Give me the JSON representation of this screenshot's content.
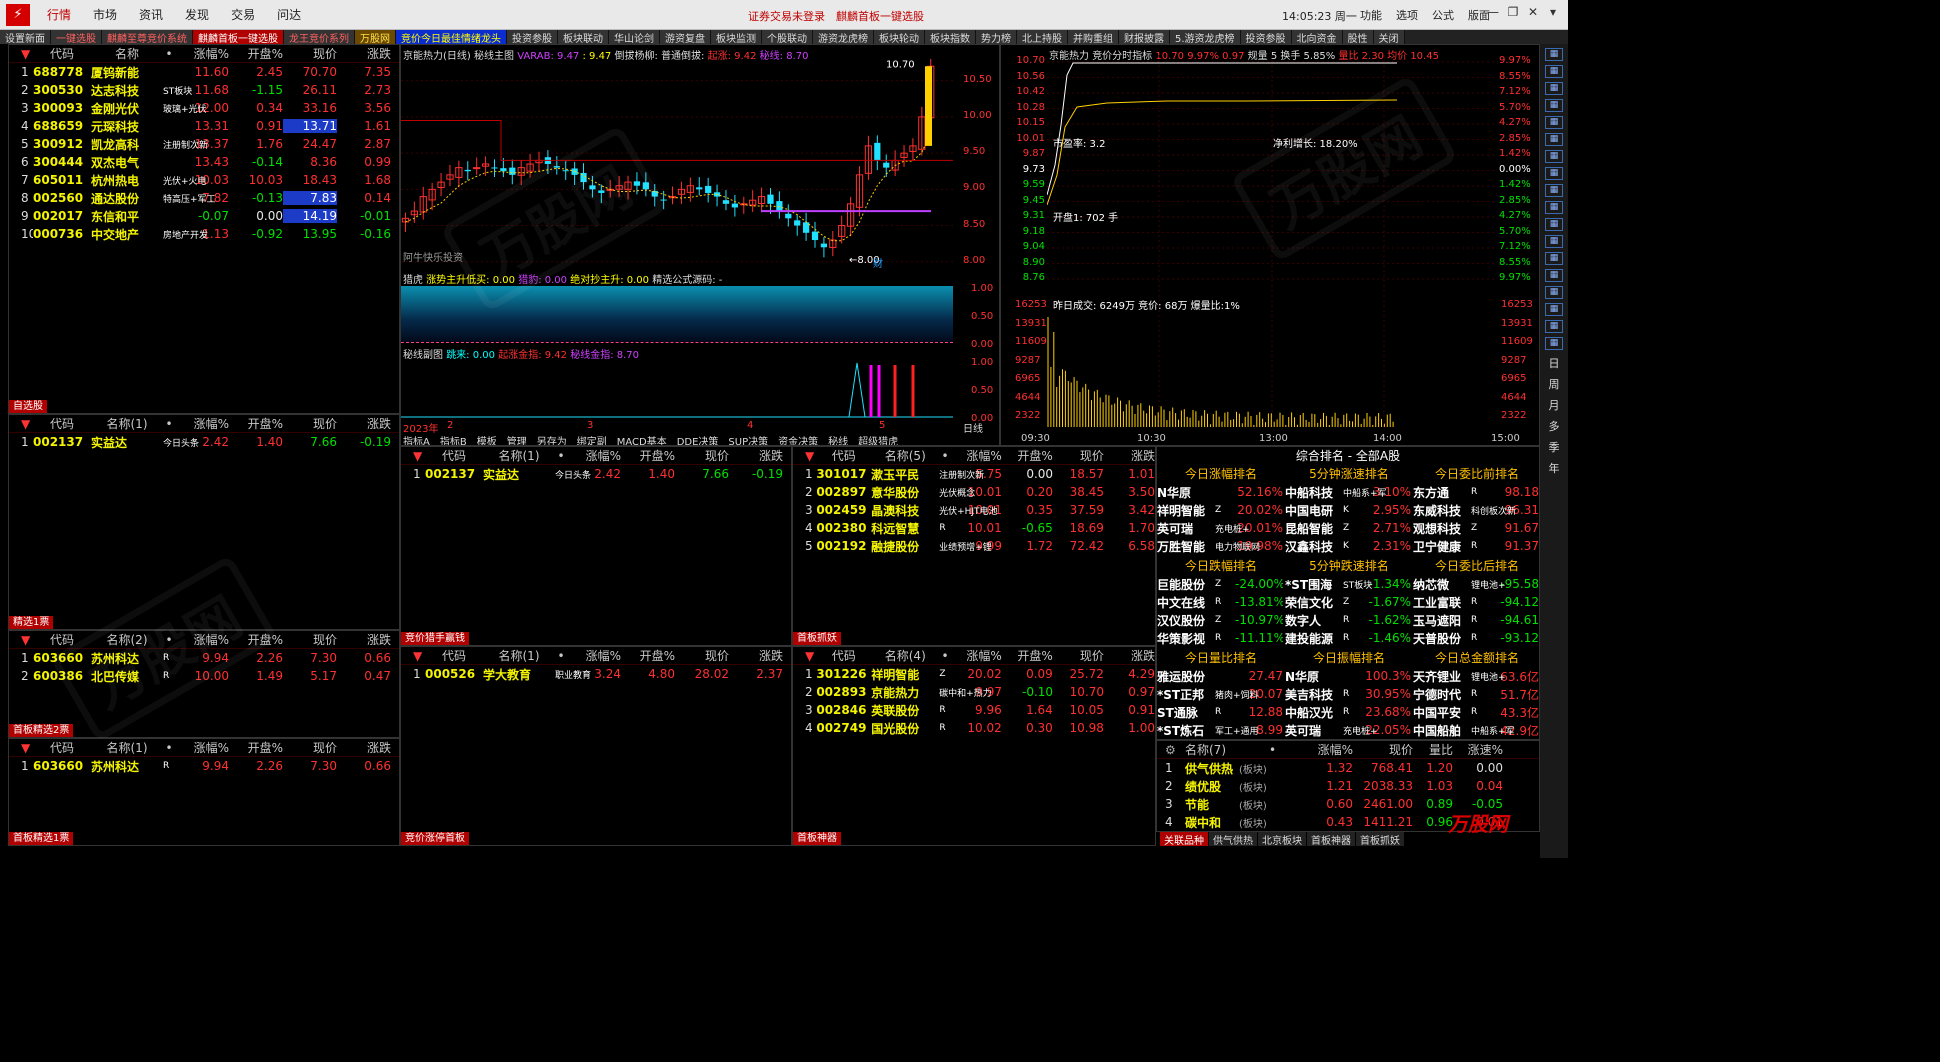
{
  "menu": {
    "items": [
      "行情",
      "市场",
      "资讯",
      "发现",
      "交易",
      "问达"
    ],
    "notice": "证券交易未登录　麒麟首板一键选股",
    "clock": "14:05:23 周一",
    "right": [
      "功能",
      "选项",
      "公式",
      "版面"
    ]
  },
  "tabs": [
    {
      "label": "设置新面",
      "cls": ""
    },
    {
      "label": "一键选股",
      "cls": "red"
    },
    {
      "label": "麒麟至尊竞价系统",
      "cls": "red"
    },
    {
      "label": "麒麟首板一键选股",
      "cls": "sel"
    },
    {
      "label": "龙王竞价系列",
      "cls": "red"
    },
    {
      "label": "万股网",
      "cls": "gold"
    },
    {
      "label": "竞价今日最佳情绪龙头",
      "cls": "blue"
    },
    {
      "label": "投资参股",
      "cls": ""
    },
    {
      "label": "板块联动",
      "cls": ""
    },
    {
      "label": "华山论剑",
      "cls": ""
    },
    {
      "label": "游资复盘",
      "cls": ""
    },
    {
      "label": "板块监测",
      "cls": ""
    },
    {
      "label": "个股联动",
      "cls": ""
    },
    {
      "label": "游资龙虎榜",
      "cls": ""
    },
    {
      "label": "板块轮动",
      "cls": ""
    },
    {
      "label": "板块指数",
      "cls": ""
    },
    {
      "label": "势力榜",
      "cls": ""
    },
    {
      "label": "北上持股",
      "cls": ""
    },
    {
      "label": "并购重组",
      "cls": ""
    },
    {
      "label": "财报披露",
      "cls": ""
    },
    {
      "label": "5.游资龙虎榜",
      "cls": ""
    },
    {
      "label": "投资参股",
      "cls": ""
    },
    {
      "label": "北向资金",
      "cls": ""
    },
    {
      "label": "股性",
      "cls": ""
    },
    {
      "label": "关闭",
      "cls": ""
    }
  ],
  "cols": [
    "代码",
    "名称",
    "•",
    "涨幅%",
    "开盘%",
    "现价",
    "涨跌"
  ],
  "main": {
    "rows": [
      [
        "1",
        "688778",
        "厦钨新能",
        "",
        "11.60",
        "2.45",
        "70.70",
        "7.35",
        "",
        ""
      ],
      [
        "2",
        "300530",
        "达志科技",
        "ST板块",
        "11.68",
        "-1.15",
        "26.11",
        "2.73",
        "",
        ""
      ],
      [
        "3",
        "300093",
        "金刚光伏",
        "玻璃+光伏",
        "12.00",
        "0.34",
        "33.16",
        "3.56",
        "",
        ""
      ],
      [
        "4",
        "688659",
        "元琛科技",
        "",
        "13.31",
        "0.91",
        "13.71",
        "1.61",
        "",
        "hl"
      ],
      [
        "5",
        "300912",
        "凯龙高科",
        "注册制次新",
        "13.37",
        "1.76",
        "24.47",
        "2.87",
        "",
        ""
      ],
      [
        "6",
        "300444",
        "双杰电气",
        "",
        "13.43",
        "-0.14",
        "8.36",
        "0.99",
        "",
        ""
      ],
      [
        "7",
        "605011",
        "杭州热电",
        "光伏+火电",
        "10.03",
        "10.03",
        "18.43",
        "1.68",
        "",
        ""
      ],
      [
        "8",
        "002560",
        "通达股份",
        "特高压+军工",
        "7.82",
        "-0.13",
        "7.83",
        "0.14",
        "",
        "hl"
      ],
      [
        "9",
        "002017",
        "东信和平",
        "",
        "-0.07",
        "0.00",
        "14.19",
        "-0.01",
        "",
        "hl"
      ],
      [
        "10",
        "000736",
        "中交地产",
        "房地产开发",
        "1.13",
        "-0.92",
        "13.95",
        "-0.16",
        "",
        ""
      ]
    ],
    "tag": "自选股"
  },
  "p2": {
    "cols": [
      "代码",
      "名称(1)",
      "•",
      "涨幅%",
      "开盘%",
      "现价",
      "涨跌"
    ],
    "rows": [
      [
        "1",
        "002137",
        "实益达",
        "今日头条",
        "2.42",
        "1.40",
        "7.66",
        "-0.19"
      ]
    ],
    "tag": "精选1票"
  },
  "p3": {
    "cols": [
      "代码",
      "名称(2)",
      "•",
      "涨幅%",
      "开盘%",
      "现价",
      "涨跌"
    ],
    "rows": [
      [
        "1",
        "603660",
        "苏州科达",
        "R",
        "9.94",
        "2.26",
        "7.30",
        "0.66"
      ],
      [
        "2",
        "600386",
        "北巴传媒",
        "R",
        "10.00",
        "1.49",
        "5.17",
        "0.47"
      ]
    ],
    "tag": "首板精选2票"
  },
  "p4": {
    "cols": [
      "代码",
      "名称(1)",
      "•",
      "涨幅%",
      "开盘%",
      "现价",
      "涨跌"
    ],
    "rows": [
      [
        "1",
        "603660",
        "苏州科达",
        "R",
        "9.94",
        "2.26",
        "7.30",
        "0.66"
      ]
    ],
    "tag": "首板精选1票"
  },
  "p5": {
    "cols": [
      "代码",
      "名称(1)",
      "•",
      "涨幅%",
      "开盘%",
      "现价",
      "涨跌"
    ],
    "rows": [
      [
        "1",
        "002137",
        "实益达",
        "今日头条",
        "2.42",
        "1.40",
        "7.66",
        "-0.19"
      ]
    ],
    "tag": "竞价猎手赢钱"
  },
  "p6": {
    "cols": [
      "代码",
      "名称(1)",
      "•",
      "涨幅%",
      "开盘%",
      "现价",
      "涨跌"
    ],
    "rows": [
      [
        "1",
        "000526",
        "学大教育",
        "职业教育",
        "3.24",
        "4.80",
        "28.02",
        "2.37"
      ]
    ],
    "tag": "竞价涨停首板"
  },
  "p7": {
    "cols": [
      "代码",
      "名称(5)",
      "•",
      "涨幅%",
      "开盘%",
      "现价",
      "涨跌"
    ],
    "rows": [
      [
        "1",
        "301017",
        "漱玉平民",
        "注册制次新",
        "5.75",
        "0.00",
        "18.57",
        "1.01"
      ],
      [
        "2",
        "002897",
        "意华股份",
        "光伏概念",
        "10.01",
        "0.20",
        "38.45",
        "3.50"
      ],
      [
        "3",
        "002459",
        "晶澳科技",
        "光伏+HJT电池",
        "10.01",
        "0.35",
        "37.59",
        "3.42"
      ],
      [
        "4",
        "002380",
        "科远智慧",
        "R",
        "10.01",
        "-0.65",
        "18.69",
        "1.70"
      ],
      [
        "5",
        "002192",
        "融捷股份",
        "业绩预增+锂",
        "9.99",
        "1.72",
        "72.42",
        "6.58"
      ]
    ],
    "tag": "首板抓妖"
  },
  "p8": {
    "cols": [
      "代码",
      "名称(4)",
      "•",
      "涨幅%",
      "开盘%",
      "现价",
      "涨跌"
    ],
    "rows": [
      [
        "1",
        "301226",
        "祥明智能",
        "Z",
        "20.02",
        "0.09",
        "25.72",
        "4.29"
      ],
      [
        "2",
        "002893",
        "京能热力",
        "碳中和+热力",
        "9.97",
        "-0.10",
        "10.70",
        "0.97"
      ],
      [
        "3",
        "002846",
        "英联股份",
        "R",
        "9.96",
        "1.64",
        "10.05",
        "0.91"
      ],
      [
        "4",
        "002749",
        "国光股份",
        "R",
        "10.02",
        "0.30",
        "10.98",
        "1.00"
      ]
    ],
    "tag": "首板神器"
  },
  "kline": {
    "title": "京能热力(日线)",
    "sub": "秘线主图",
    "vara": "VARAB: 9.47",
    "v2": ": 9.47",
    "b1": "倒拔杨柳:",
    "b2": "普通倒拔:",
    "b3": "起涨: 9.42",
    "b4": "秘线: 8.70",
    "hi": "10.70",
    "lo": "8.00",
    "cai": "财",
    "wm": "阿牛快乐投资",
    "y": [
      "10.50",
      "10.00",
      "9.50",
      "9.00",
      "8.50",
      "8.00"
    ],
    "ind1": {
      "title": "猎虎",
      "a": "涨势主升低买: 0.00",
      "b": "猎豹: 0.00",
      "c": "绝对抄主升: 0.00",
      "d": "精选公式源码: -",
      "y": [
        "1.00",
        "0.50",
        "0.00"
      ]
    },
    "ind2": {
      "title": "秘线副图",
      "a": "跳来: 0.00",
      "b": "起涨金指: 9.42",
      "c": "秘线金指: 8.70",
      "y": [
        "1.00",
        "0.50",
        "0.00"
      ]
    },
    "xaxis": [
      "2023年",
      "2",
      "3",
      "4",
      "5"
    ],
    "xtail": "日线",
    "tabs": [
      "指标A",
      "指标B",
      "模板",
      "管理",
      "另存为",
      "绑定副",
      "MACD基本",
      "DDE决策",
      "SUP决策",
      "资金决策",
      "秘线",
      "超级猎虎"
    ]
  },
  "intraday": {
    "title": "京能热力",
    "sub": "竞价分时指标",
    "price": "10.70",
    "pct": "9.97%",
    "chg": "0.97",
    "vol": "规量",
    "hs": "5 换手 5.85%",
    "lb": "量比 2.30",
    "avg": "均价 10.45",
    "ly": [
      "10.70",
      "10.56",
      "10.42",
      "10.28",
      "10.15",
      "10.01",
      "9.87",
      "9.73",
      "9.59",
      "9.45",
      "9.31",
      "9.18",
      "9.04",
      "8.90",
      "8.76"
    ],
    "ry": [
      "9.97%",
      "8.55%",
      "7.12%",
      "5.70%",
      "4.27%",
      "2.85%",
      "1.42%",
      "0.00%",
      "1.42%",
      "2.85%",
      "4.27%",
      "5.70%",
      "7.12%",
      "8.55%",
      "9.97%"
    ],
    "vy": [
      "16253",
      "13931",
      "11609",
      "9287",
      "6965",
      "4644",
      "2322"
    ],
    "t1": "市盈率: 3.2",
    "t2": "净利增长: 18.20%",
    "t3": "开盘1: 702 手",
    "t4": "昨日成交: 6249万 竞价: 68万 爆量比:1%",
    "x": [
      "09:30",
      "10:30",
      "13:00",
      "14:00",
      "15:00"
    ]
  },
  "rank": {
    "title": "综合排名 - 全部A股",
    "g": [
      {
        "t": "今日涨幅排名",
        "rows": [
          [
            "N华原",
            "",
            "52.16%"
          ],
          [
            "祥明智能",
            "Z",
            "20.02%"
          ],
          [
            "英可瑞",
            "充电桩+",
            "20.01%"
          ],
          [
            "万胜智能",
            "电力物联网",
            "19.98%"
          ]
        ]
      },
      {
        "t": "5分钟涨速排名",
        "rows": [
          [
            "中船科技",
            "中船系+军",
            "3.10%"
          ],
          [
            "中国电研",
            "K",
            "2.95%"
          ],
          [
            "昆船智能",
            "Z",
            "2.71%"
          ],
          [
            "汉鑫科技",
            "K",
            "2.31%"
          ]
        ]
      },
      {
        "t": "今日委比前排名",
        "rows": [
          [
            "东方通",
            "R",
            "98.18"
          ],
          [
            "东威科技",
            "科创板次新",
            "96.31"
          ],
          [
            "观想科技",
            "Z",
            "91.67"
          ],
          [
            "卫宁健康",
            "R",
            "91.37"
          ]
        ]
      },
      {
        "t": "今日跌幅排名",
        "rows": [
          [
            "巨能股份",
            "Z",
            "-24.00%"
          ],
          [
            "中文在线",
            "R",
            "-13.81%"
          ],
          [
            "汉仪股份",
            "Z",
            "-10.97%"
          ],
          [
            "华策影视",
            "R",
            "-11.11%"
          ]
        ]
      },
      {
        "t": "5分钟跌速排名",
        "rows": [
          [
            "*ST围海",
            "ST板块",
            "-1.34%"
          ],
          [
            "荣信文化",
            "Z",
            "-1.67%"
          ],
          [
            "数字人",
            "R",
            "-1.62%"
          ],
          [
            "建投能源",
            "R",
            "-1.46%"
          ]
        ]
      },
      {
        "t": "今日委比后排名",
        "rows": [
          [
            "纳芯微",
            "锂电池+",
            "-95.58"
          ],
          [
            "工业富联",
            "R",
            "-94.12"
          ],
          [
            "玉马遮阳",
            "R",
            "-94.61"
          ],
          [
            "天普股份",
            "R",
            "-93.12"
          ]
        ]
      },
      {
        "t": "今日量比排名",
        "rows": [
          [
            "雅运股份",
            "",
            "27.47"
          ],
          [
            "*ST正邦",
            "猪肉+饲料",
            "20.07"
          ],
          [
            "ST通脉",
            "R",
            "12.88"
          ],
          [
            "*ST炼石",
            "军工+通用",
            "8.99"
          ]
        ]
      },
      {
        "t": "今日振幅排名",
        "rows": [
          [
            "N华原",
            "",
            "100.3%"
          ],
          [
            "美吉科技",
            "R",
            "30.95%"
          ],
          [
            "中船汉光",
            "R",
            "23.68%"
          ],
          [
            "英可瑞",
            "充电桩+",
            "22.05%"
          ]
        ]
      },
      {
        "t": "今日总金额排名",
        "rows": [
          [
            "天齐锂业",
            "锂电池+",
            "63.6亿"
          ],
          [
            "宁德时代",
            "R",
            "51.7亿"
          ],
          [
            "中国平安",
            "R",
            "43.3亿"
          ],
          [
            "中国船舶",
            "中船系+军",
            "42.9亿"
          ]
        ]
      }
    ]
  },
  "board": {
    "cols": [
      "名称(7)",
      "•",
      "涨幅%",
      "现价",
      "量比",
      "涨速%"
    ],
    "rows": [
      [
        "1",
        "供气供热",
        "(板块)",
        "1.32",
        "768.41",
        "1.20",
        "0.00"
      ],
      [
        "2",
        "绩优股",
        "(板块)",
        "1.21",
        "2038.33",
        "1.03",
        "0.04"
      ],
      [
        "3",
        "节能",
        "(板块)",
        "0.60",
        "2461.00",
        "0.89",
        "-0.05"
      ],
      [
        "4",
        "碳中和",
        "(板块)",
        "0.43",
        "1411.21",
        "0.96",
        "0.01"
      ]
    ]
  },
  "bottabs": [
    "关联品种",
    "供气供热",
    "北京板块",
    "首板神器",
    "首板抓妖"
  ],
  "sidebar": [
    "日",
    "周",
    "月",
    "多",
    "季",
    "年"
  ],
  "watermark": "万股网",
  "logo": "万股网"
}
